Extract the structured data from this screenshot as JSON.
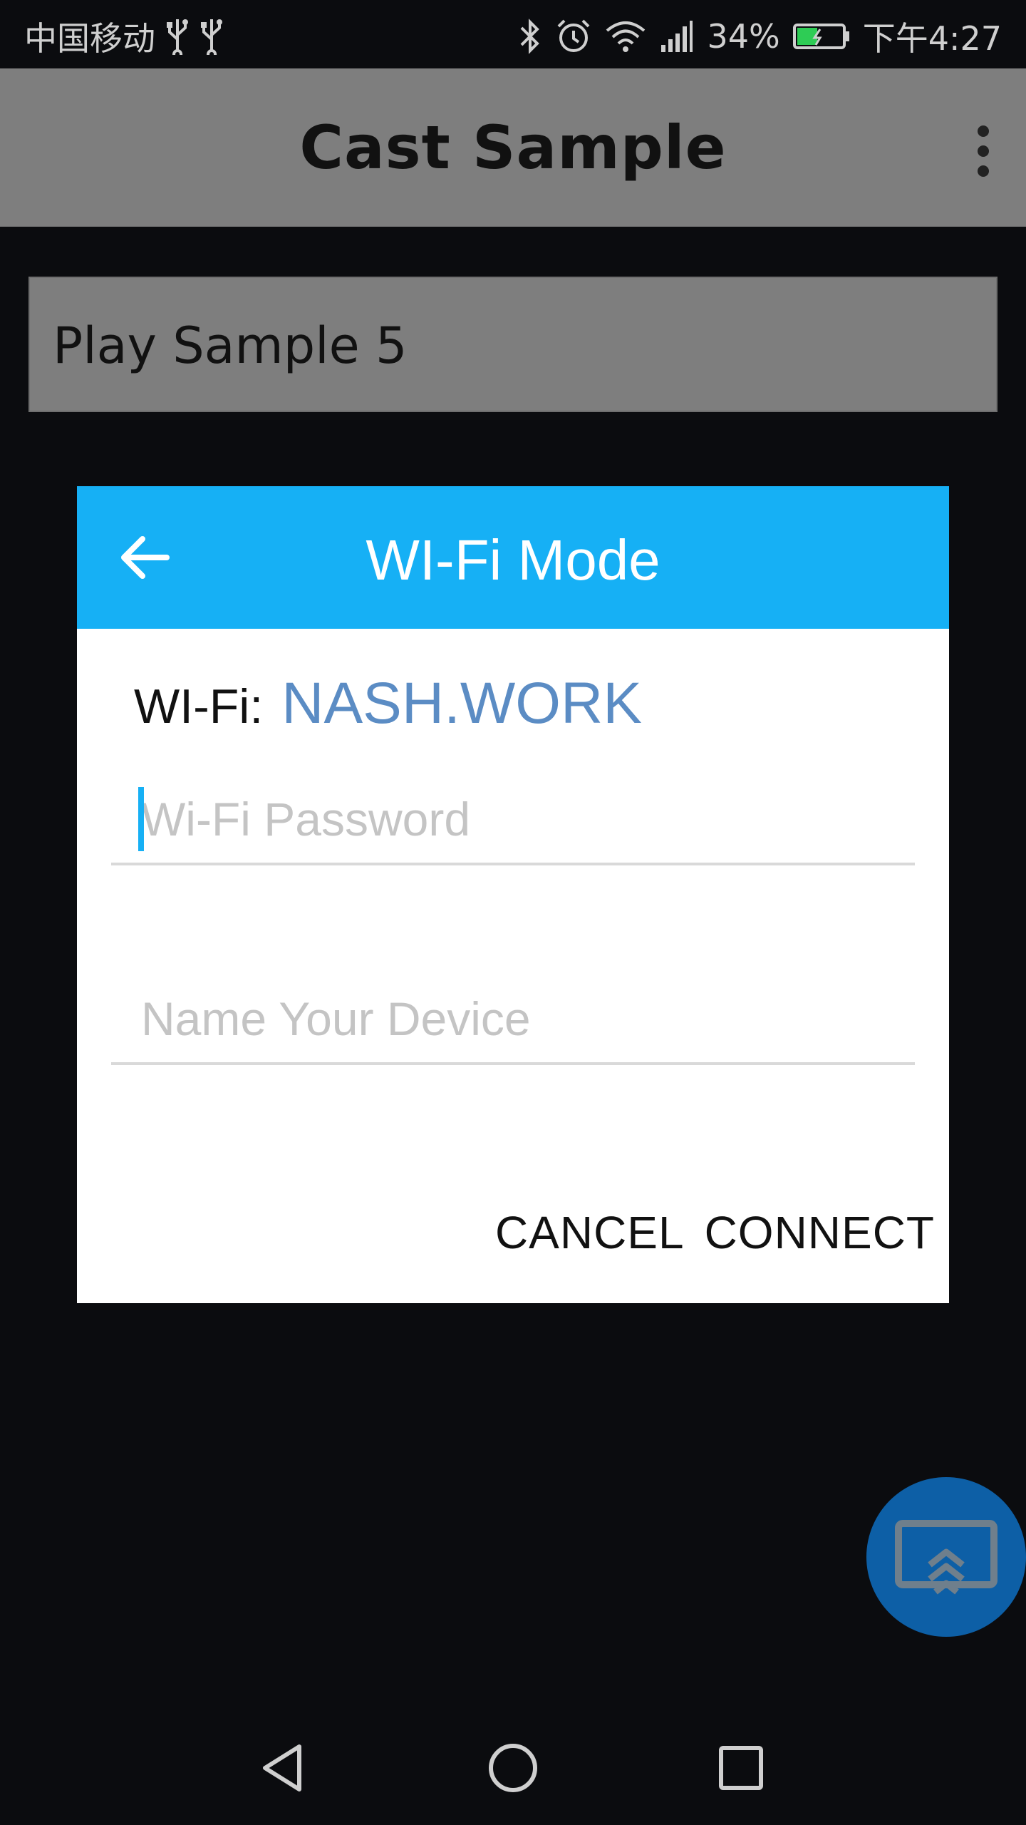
{
  "status_bar": {
    "carrier": "中国移动",
    "battery_percent": "34%",
    "time": "下午4:27",
    "icons": [
      "usb-icon",
      "usb-icon",
      "bluetooth-icon",
      "alarm-icon",
      "wifi-icon",
      "signal-icon",
      "battery-icon"
    ]
  },
  "app_bar": {
    "title": "Cast Sample"
  },
  "main": {
    "sample_button_label": "Play Sample 5"
  },
  "dialog": {
    "title": "WI-Fi Mode",
    "wifi_label": "WI-Fi:",
    "wifi_ssid": "NASH.WORK",
    "password_placeholder": "Wi-Fi Password",
    "password_value": "",
    "device_name_placeholder": "Name Your Device",
    "device_name_value": "",
    "cancel_label": "CANCEL",
    "connect_label": "CONNECT"
  },
  "colors": {
    "dialog_header": "#16b0f5",
    "ssid_text": "#5b8cc4",
    "fab": "#0d5fa6"
  }
}
